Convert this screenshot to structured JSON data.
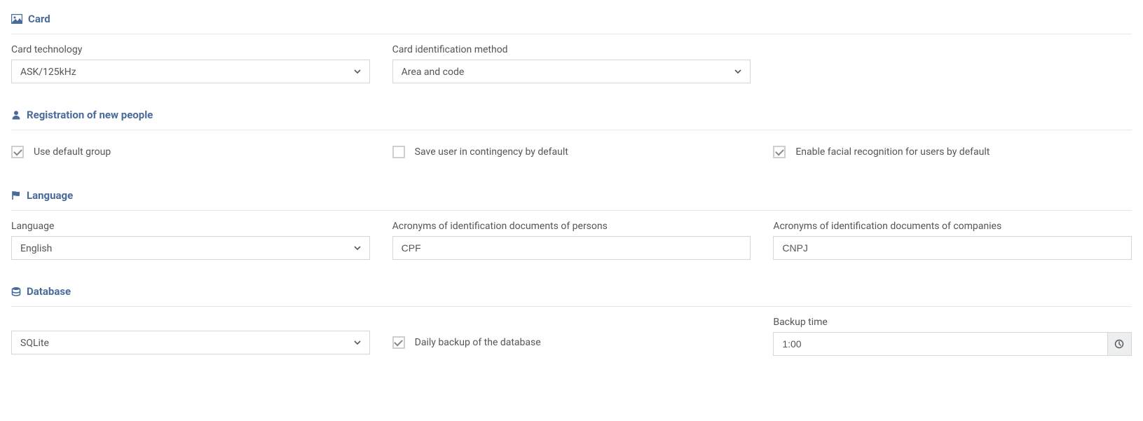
{
  "card": {
    "title": "Card",
    "technology_label": "Card technology",
    "technology_value": "ASK/125kHz",
    "id_method_label": "Card identification method",
    "id_method_value": "Area and code"
  },
  "registration": {
    "title": "Registration of new people",
    "use_default_group_label": "Use default group",
    "use_default_group_checked": true,
    "save_contingency_label": "Save user in contingency by default",
    "save_contingency_checked": false,
    "enable_facial_label": "Enable facial recognition for users by default",
    "enable_facial_checked": true
  },
  "language": {
    "title": "Language",
    "language_label": "Language",
    "language_value": "English",
    "persons_acronym_label": "Acronyms of identification documents of persons",
    "persons_acronym_value": "CPF",
    "companies_acronym_label": "Acronyms of identification documents of companies",
    "companies_acronym_value": "CNPJ"
  },
  "database": {
    "title": "Database",
    "engine_value": "SQLite",
    "daily_backup_label": "Daily backup of the database",
    "daily_backup_checked": true,
    "backup_time_label": "Backup time",
    "backup_time_value": "1:00"
  }
}
